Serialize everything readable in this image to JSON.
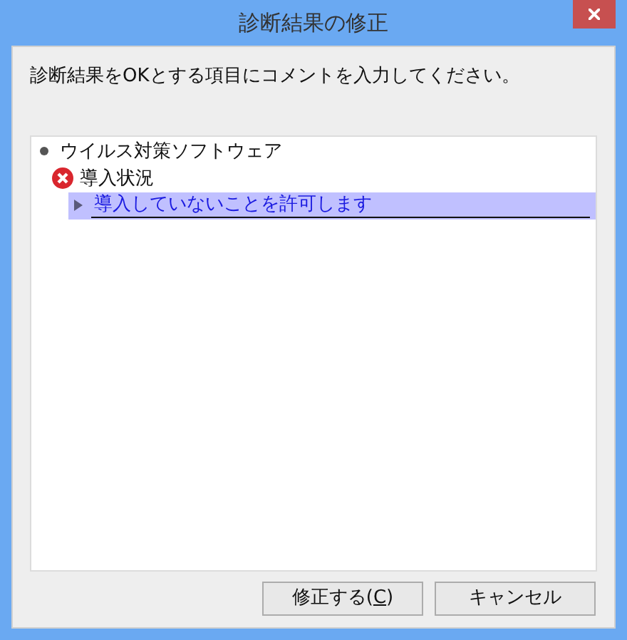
{
  "window": {
    "title": "診断結果の修正"
  },
  "instruction": "診断結果をOKとする項目にコメントを入力してください。",
  "tree": [
    {
      "kind": "category",
      "label": "ウイルス対策ソフトウェア",
      "children": [
        {
          "kind": "error",
          "label": "導入状況",
          "children": [
            {
              "kind": "comment",
              "label": "導入していないことを許可します",
              "selected": true
            }
          ]
        }
      ]
    }
  ],
  "buttons": [
    {
      "label_before": "修正する(",
      "mnemonic": "C",
      "label_after": ")"
    },
    {
      "label_before": "キャンセル"
    }
  ]
}
